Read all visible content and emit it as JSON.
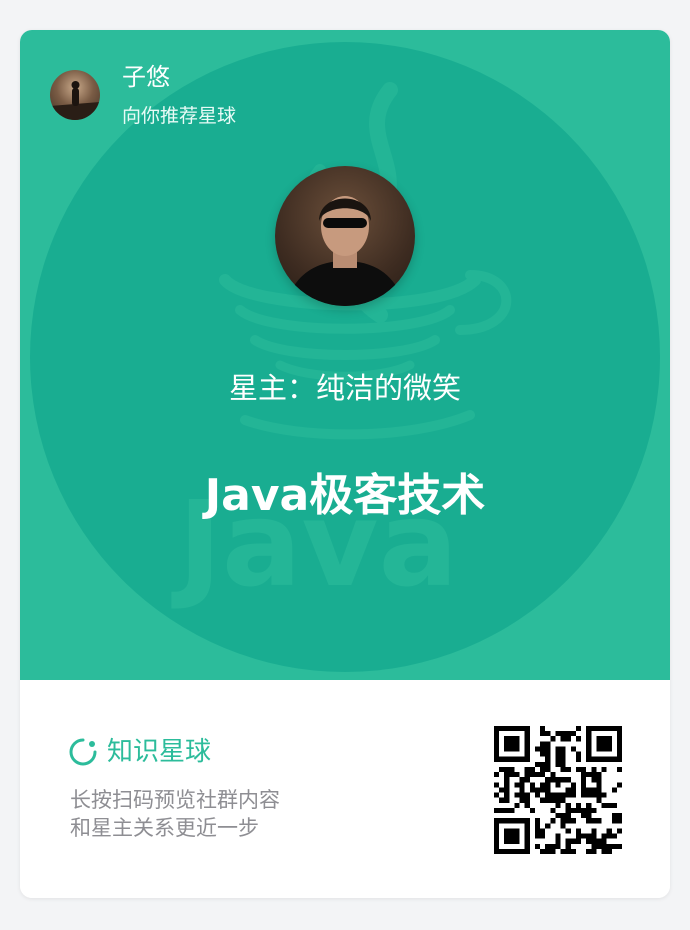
{
  "share_card": {
    "inviter": {
      "name": "子悠",
      "subtitle": "向你推荐星球"
    },
    "owner_line": "星主：纯洁的微笑",
    "group_name": "Java极客技术",
    "watermark_text": "Java",
    "footer": {
      "brand": "知识星球",
      "hint_line1": "长按扫码预览社群内容",
      "hint_line2": "和星主关系更近一步"
    },
    "colors": {
      "accent": "#2cbc9b",
      "hero_circle": "#19ad91",
      "hint_text": "#8e8e93"
    },
    "icons": {
      "brand": "planet-ring-icon",
      "qr": "qr-code"
    }
  }
}
